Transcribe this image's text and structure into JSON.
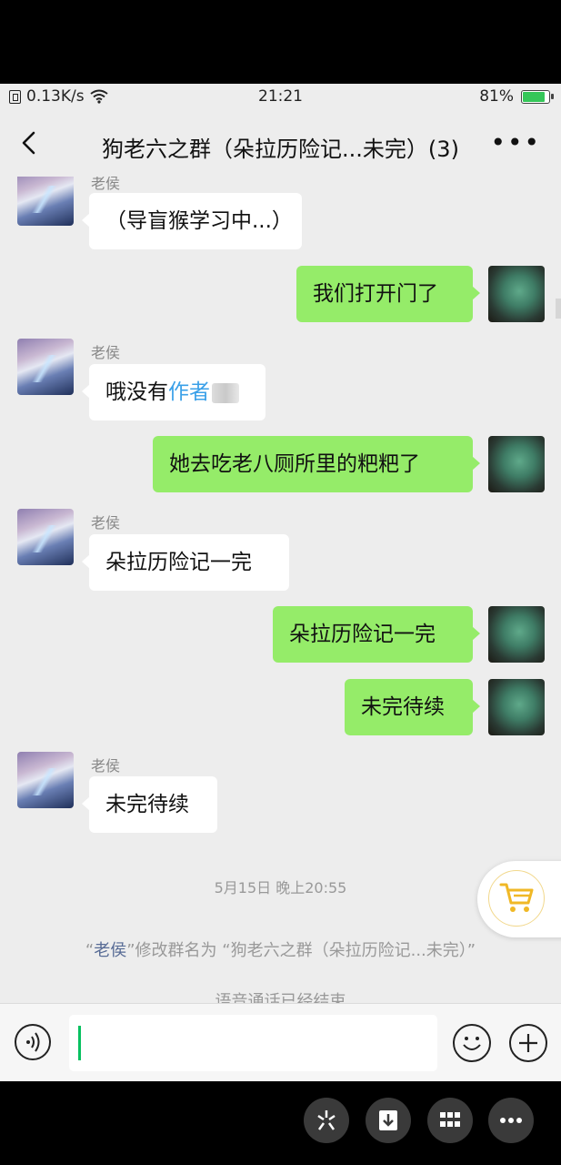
{
  "status_bar": {
    "speed": "0.13K/s",
    "time": "21:21",
    "battery": "81%"
  },
  "header": {
    "title": "狗老六之群（朵拉历险记...未完）(3)"
  },
  "messages": [
    {
      "sender": "老侯",
      "text": "（导盲猴学习中...）"
    },
    {
      "text": "我们打开门了"
    },
    {
      "sender": "老侯",
      "text": "哦没有",
      "watermark": "作者"
    },
    {
      "text": "她去吃老八厕所里的粑粑了"
    },
    {
      "sender": "老侯",
      "text": "朵拉历险记一完"
    },
    {
      "text": "朵拉历险记一完"
    },
    {
      "text": "未完待续"
    },
    {
      "sender": "老侯",
      "text": "未完待续"
    }
  ],
  "timestamp": "5月15日 晚上20:55",
  "system": {
    "rename_who": "老侯",
    "rename_text": "修改群名为 “狗老六之群（朵拉历险记...未完）”",
    "voice_end": "语音通话已经结束"
  },
  "colors": {
    "out_bubble": "#95ec69",
    "in_bubble": "#ffffff",
    "cursor": "#07c160"
  },
  "icons": [
    "back-icon",
    "more-icon",
    "voice-icon",
    "emoji-icon",
    "plus-icon",
    "cart-icon"
  ]
}
